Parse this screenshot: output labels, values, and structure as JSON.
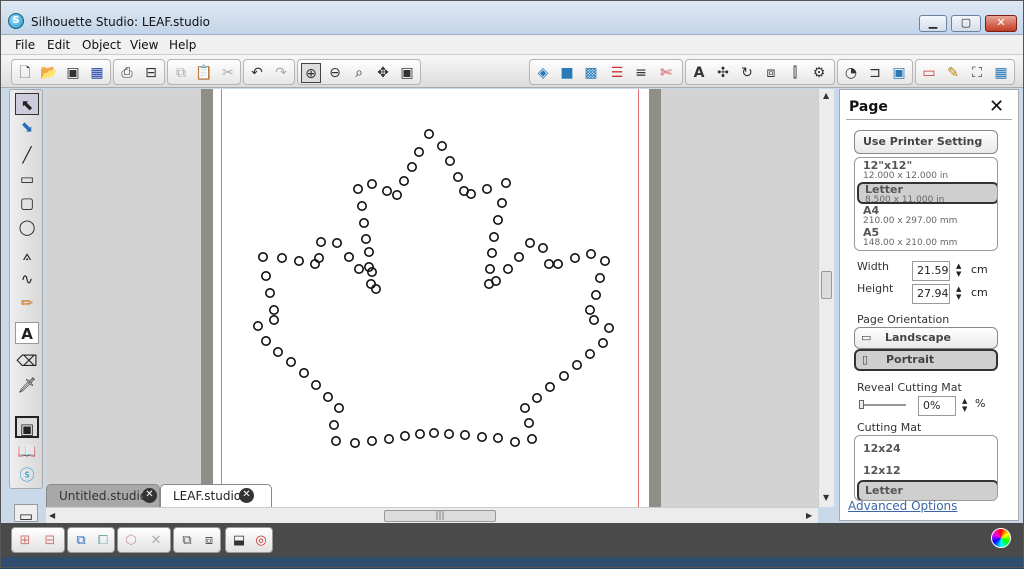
{
  "window": {
    "title": "Silhouette Studio: LEAF.studio"
  },
  "menu": {
    "items": [
      "File",
      "Edit",
      "Object",
      "View",
      "Help"
    ]
  },
  "tabs": [
    {
      "label": "Untitled.studio"
    },
    {
      "label": "LEAF.studio"
    }
  ],
  "panel": {
    "title": "Page",
    "printer_button": "Use Printer Setting",
    "page_sizes": [
      {
        "name": "12\"x12\"",
        "dims": "12.000 x 12.000 in"
      },
      {
        "name": "Letter",
        "dims": "8.500 x 11.000 in",
        "selected": true
      },
      {
        "name": "A4",
        "dims": "210.00 x 297.00 mm"
      },
      {
        "name": "A5",
        "dims": "148.00 x 210.00 mm"
      }
    ],
    "width_label": "Width",
    "width_value": "21.590",
    "height_label": "Height",
    "height_value": "27.940",
    "unit": "cm",
    "orientation_label": "Page Orientation",
    "orientation_options": [
      "Landscape",
      "Portrait"
    ],
    "orientation_selected": "Portrait",
    "reveal_label": "Reveal Cutting Mat",
    "reveal_value": "0%",
    "reveal_unit": "%",
    "cutting_mat_label": "Cutting Mat",
    "cutting_mats": [
      "12x24",
      "12x12",
      "Letter"
    ],
    "cutting_mat_selected": "Letter",
    "advanced_link": "Advanced Options"
  },
  "colors": {
    "cut_line": "#e27171",
    "accent": "#3b65a8",
    "titlebar": "#c3d4e8"
  },
  "icons": [
    "app-icon",
    "new-icon",
    "open-icon",
    "save-icon",
    "save-sd-icon",
    "print-icon",
    "cut-settings-icon",
    "copy-icon",
    "paste-icon",
    "cut-icon",
    "undo-icon",
    "redo-icon",
    "zoom-in-icon",
    "zoom-out-icon",
    "zoom-box-icon",
    "pan-icon",
    "fit-page-icon",
    "fill-icon",
    "line-style-icon",
    "trace-icon",
    "text-style-icon",
    "transform-icon",
    "replicate-icon",
    "modify-icon",
    "offset-icon",
    "knife-icon",
    "library-icon",
    "store-icon",
    "cut-send-icon",
    "pencil-icon",
    "fullscreen-icon",
    "grid-icon",
    "select-icon",
    "edit-points-icon",
    "line-tool-icon",
    "rect-tool-icon",
    "rounded-rect-icon",
    "ellipse-icon",
    "polygon-icon",
    "curve-icon",
    "freehand-icon",
    "text-tool-icon",
    "eraser-icon",
    "knife-tool-icon",
    "page-icon",
    "book-icon",
    "silhouette-store-icon",
    "color-wheel-icon"
  ]
}
